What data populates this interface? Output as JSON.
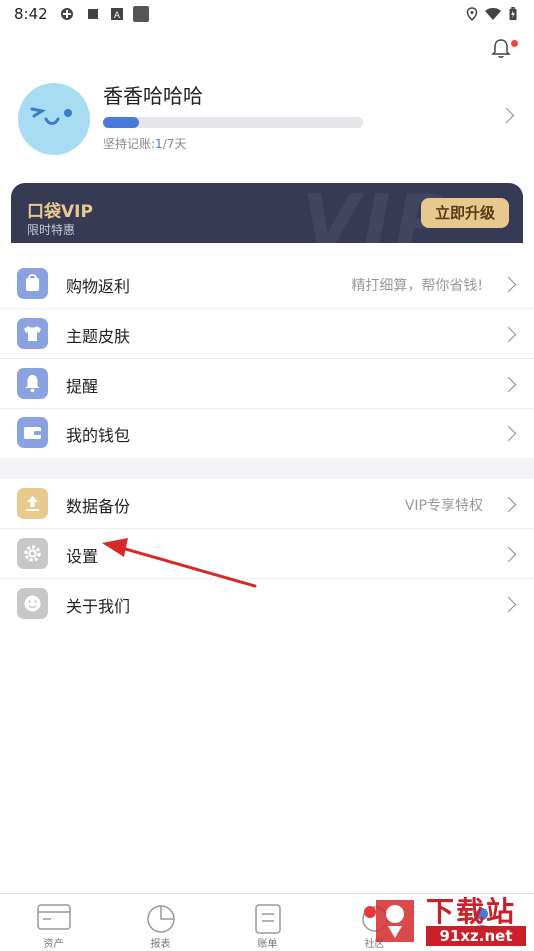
{
  "status_bar": {
    "time": "8:42"
  },
  "profile": {
    "username": "香香哈哈哈",
    "streak_label": "坚持记账:",
    "streak_current": "1",
    "streak_total": "/7天",
    "progress": 0.14
  },
  "vip": {
    "title": "口袋VIP",
    "subtitle": "限时特惠",
    "upgrade_label": "立即升级",
    "watermark": "VIP"
  },
  "menu": [
    {
      "label": "购物返利",
      "hint": "精打细算，帮你省钱!",
      "icon": "shopping-bag-icon",
      "color": "#8aa3e0"
    },
    {
      "label": "主题皮肤",
      "hint": "",
      "icon": "tshirt-icon",
      "color": "#8aa3e0"
    },
    {
      "label": "提醒",
      "hint": "",
      "icon": "bell-icon",
      "color": "#8aa3e0"
    },
    {
      "label": "我的钱包",
      "hint": "",
      "icon": "wallet-icon",
      "color": "#8aa3e0"
    },
    {
      "label": "数据备份",
      "hint": "VIP专享特权",
      "icon": "upload-icon",
      "color": "#e8c98e"
    },
    {
      "label": "设置",
      "hint": "",
      "icon": "gear-icon",
      "color": "#c7c7c7"
    },
    {
      "label": "关于我们",
      "hint": "",
      "icon": "smiley-icon",
      "color": "#c7c7c7"
    }
  ],
  "bottom_nav": [
    {
      "label": "资产",
      "icon": "card-icon"
    },
    {
      "label": "报表",
      "icon": "pie-chart-icon"
    },
    {
      "label": "账单",
      "icon": "document-icon"
    },
    {
      "label": "社区",
      "icon": "community-icon"
    },
    {
      "label": "",
      "icon": "user-icon"
    }
  ],
  "watermark": {
    "brand": "下载站",
    "url": "91xz.net"
  },
  "colors": {
    "accent": "#4a7ad8",
    "vip_bg": "#363a55",
    "vip_gold": "#e8c98e",
    "annotation_arrow": "#d42a2a"
  }
}
